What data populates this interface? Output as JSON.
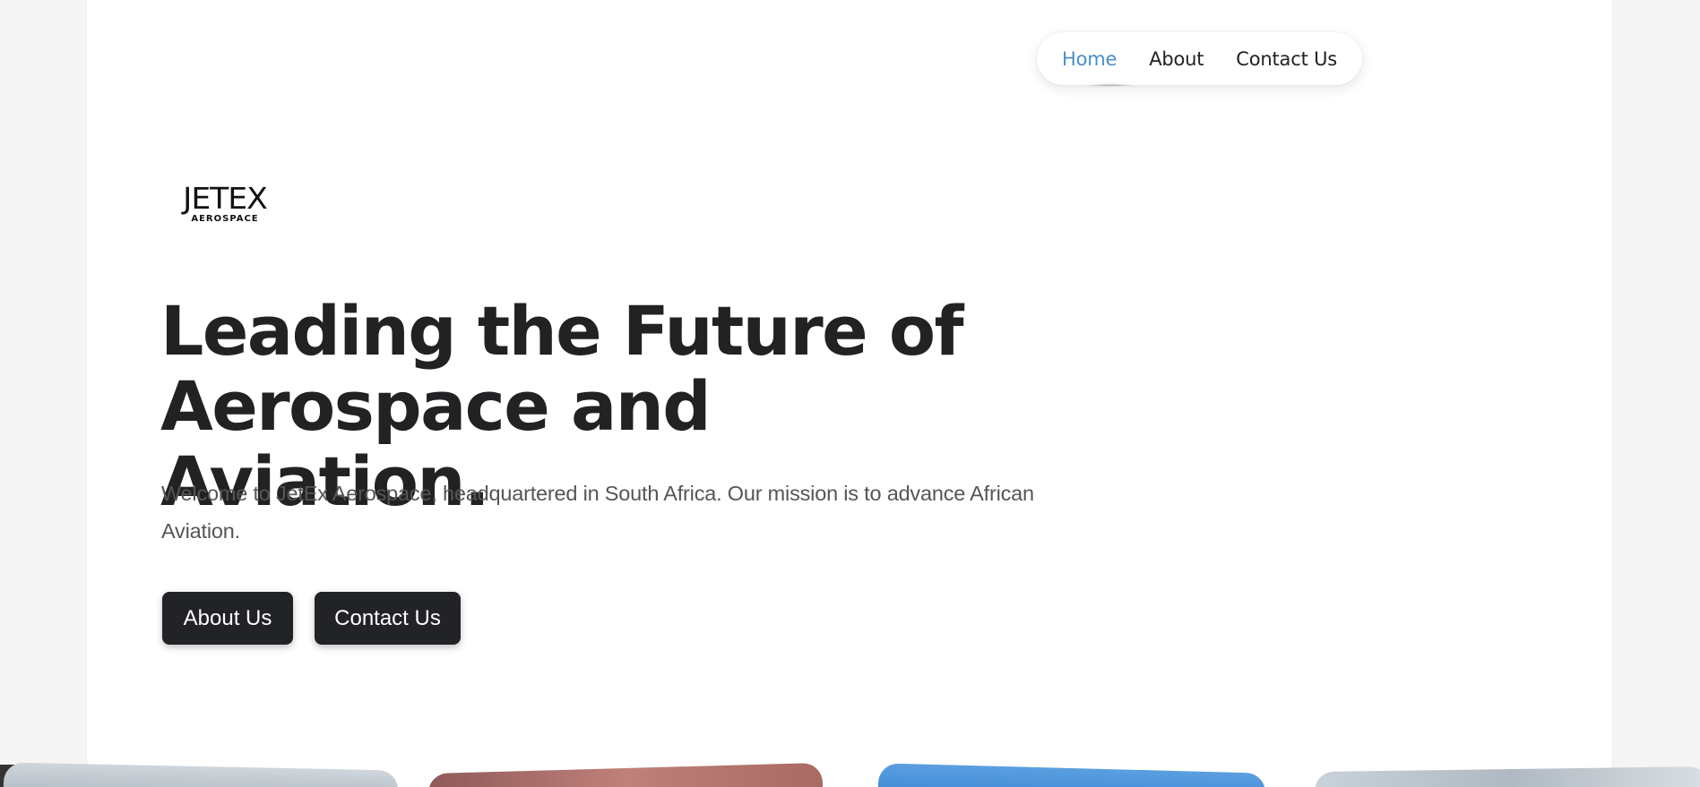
{
  "nav": {
    "items": [
      {
        "label": "Home",
        "active": true
      },
      {
        "label": "About",
        "active": false
      },
      {
        "label": "Contact Us",
        "active": false
      }
    ],
    "active_color": "#4a8ecb"
  },
  "logo": {
    "line1": "JETEX",
    "line2": "AEROSPACE"
  },
  "hero": {
    "title_line1": "Leading the Future of",
    "title_line2": "Aerospace and Aviation.",
    "lead": "Welcome to JetEx Aerospace, headquartered in South Africa. Our mission is to advance African Aviation.",
    "button_about": "About Us",
    "button_contact": "Contact Us"
  },
  "colors": {
    "button_bg": "#222327",
    "text_dark": "#222225",
    "text_muted": "#555555"
  }
}
